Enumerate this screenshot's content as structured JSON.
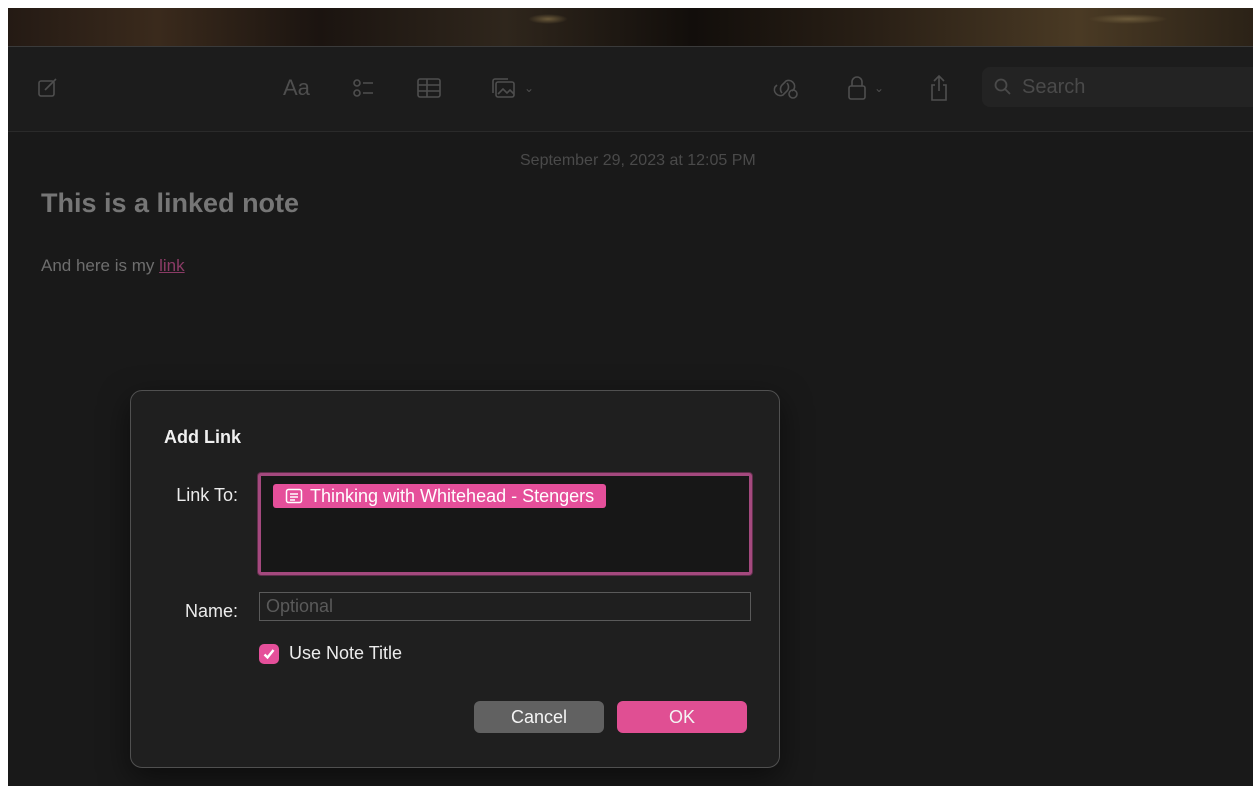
{
  "toolbar": {
    "format_label": "Aa",
    "search_placeholder": "Search"
  },
  "note": {
    "date": "September 29, 2023 at 12:05 PM",
    "title": "This is a linked note",
    "body_prefix": "And here is my ",
    "link_text": "link"
  },
  "dialog": {
    "title": "Add Link",
    "link_to_label": "Link To:",
    "link_target": "Thinking with Whitehead - Stengers",
    "name_label": "Name:",
    "name_value": "",
    "name_placeholder": "Optional",
    "use_note_title_label": "Use Note Title",
    "use_note_title_checked": true,
    "cancel_label": "Cancel",
    "ok_label": "OK"
  },
  "colors": {
    "accent": "#e54f9a",
    "background": "#191919",
    "dialog_background": "#1f1f1f"
  },
  "icons": [
    "new-note-icon",
    "checklist-icon",
    "table-icon",
    "media-icon",
    "collaborate-icon",
    "lock-icon",
    "share-icon",
    "search-icon",
    "note-icon",
    "checkmark-icon"
  ]
}
